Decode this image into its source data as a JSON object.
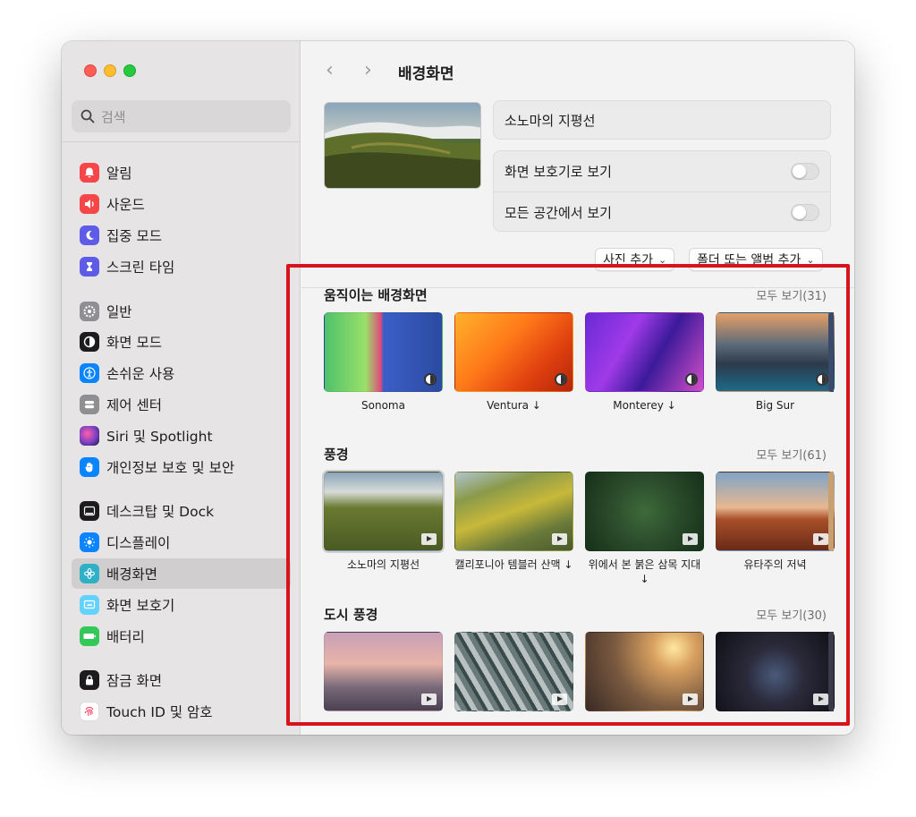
{
  "sidebar": {
    "search_placeholder": "검색",
    "items": [
      {
        "label": "알림",
        "icon": "bell-icon",
        "color": "#f5474a"
      },
      {
        "label": "사운드",
        "icon": "speaker-icon",
        "color": "#f5474a"
      },
      {
        "label": "집중 모드",
        "icon": "moon-icon",
        "color": "#5e5ce6"
      },
      {
        "label": "스크린 타임",
        "icon": "hourglass-icon",
        "color": "#5e5ce6"
      },
      {
        "label": "일반",
        "icon": "gear-icon",
        "color": "#8e8e93"
      },
      {
        "label": "화면 모드",
        "icon": "appearance-icon",
        "color": "#1c1c1e"
      },
      {
        "label": "손쉬운 사용",
        "icon": "accessibility-icon",
        "color": "#0a84ff"
      },
      {
        "label": "제어 센터",
        "icon": "control-center-icon",
        "color": "#8e8e93"
      },
      {
        "label": "Siri 및 Spotlight",
        "icon": "siri-icon",
        "color": "#7a3fc4"
      },
      {
        "label": "개인정보 보호 및 보안",
        "icon": "hand-icon",
        "color": "#0a84ff"
      },
      {
        "label": "데스크탑 및 Dock",
        "icon": "dock-icon",
        "color": "#1c1c1e"
      },
      {
        "label": "디스플레이",
        "icon": "sun-icon",
        "color": "#0a84ff"
      },
      {
        "label": "배경화면",
        "icon": "wallpaper-icon",
        "color": "#30b0c7"
      },
      {
        "label": "화면 보호기",
        "icon": "screensaver-icon",
        "color": "#64d2ff"
      },
      {
        "label": "배터리",
        "icon": "battery-icon",
        "color": "#34c759"
      },
      {
        "label": "잠금 화면",
        "icon": "lock-icon",
        "color": "#1c1c1e"
      },
      {
        "label": "Touch ID 및 암호",
        "icon": "fingerprint-icon",
        "color": "#ffffff"
      }
    ]
  },
  "header": {
    "title": "배경화면"
  },
  "current": {
    "name": "소노마의 지평선",
    "option_screensaver": "화면 보호기로 보기",
    "option_all_spaces": "모든 공간에서 보기"
  },
  "buttons": {
    "add_photo": "사진 추가",
    "add_folder": "폴더 또는 앨범 추가"
  },
  "sections": [
    {
      "title": "움직이는 배경화면",
      "more": "모두 보기(31)",
      "items": [
        {
          "label": "Sonoma"
        },
        {
          "label": "Ventura ↓"
        },
        {
          "label": "Monterey ↓"
        },
        {
          "label": "Big Sur"
        }
      ]
    },
    {
      "title": "풍경",
      "more": "모두 보기(61)",
      "items": [
        {
          "label": "소노마의 지평선"
        },
        {
          "label": "캘리포니아 템블러 산맥 ↓"
        },
        {
          "label": "위에서 본 붉은 삼목 지대 ↓"
        },
        {
          "label": "유타주의 저녁"
        }
      ]
    },
    {
      "title": "도시 풍경",
      "more": "모두 보기(30)",
      "items": [
        {
          "label": ""
        },
        {
          "label": ""
        },
        {
          "label": ""
        },
        {
          "label": ""
        }
      ]
    }
  ],
  "colors": {
    "highlight_border": "#d7141c",
    "active_sidebar": "#d0cecf"
  }
}
